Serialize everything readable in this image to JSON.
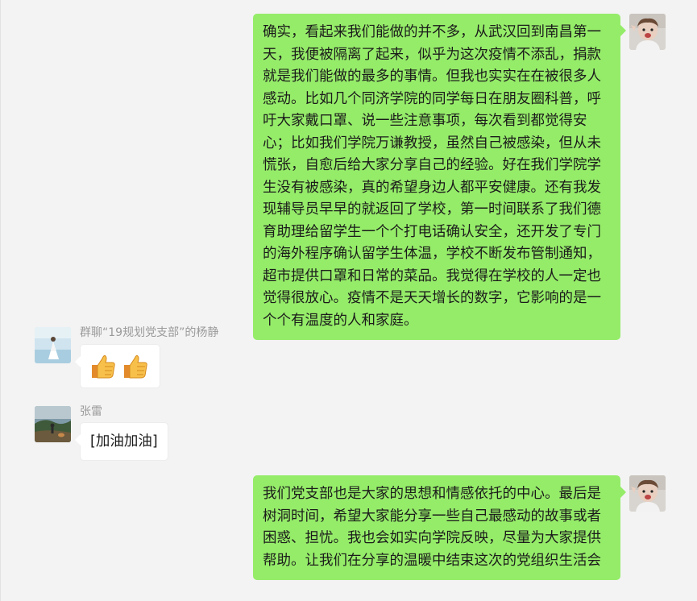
{
  "messages": [
    {
      "direction": "outgoing",
      "avatar": "child-photo-avatar",
      "text": "确实，看起来我们能做的并不多，从武汉回到南昌第一天，我便被隔离了起来，似乎为这次疫情不添乱，捐款就是我们能做的最多的事情。但我也实实在在被很多人感动。比如几个同济学院的同学每日在朋友圈科普，呼吁大家戴口罩、说一些注意事项，每次看到都觉得安心；比如我们学院万谦教授，虽然自己被感染，但从未慌张，自愈后给大家分享自己的经验。好在我们学院学生没有被感染，真的希望身边人都平安健康。还有我发现辅导员早早的就返回了学校，第一时间联系了我们德育助理给留学生一个个打电话确认安全，还开发了专门的海外程序确认留学生体温，学校不断发布管制通知，超市提供口罩和日常的菜品。我觉得在学校的人一定也觉得很放心。疫情不是天天增长的数字，它影响的是一个个有温度的人和家庭。"
    },
    {
      "direction": "incoming",
      "sender": "群聊“19规划党支部”的杨静",
      "avatar": "figure-in-white-dress-avatar",
      "emoji": [
        "thumbs-up-icon",
        "thumbs-up-icon"
      ]
    },
    {
      "direction": "incoming",
      "sender": "张雷",
      "avatar": "outdoor-landscape-avatar",
      "text": "[加油加油]"
    },
    {
      "direction": "outgoing",
      "avatar": "child-photo-avatar",
      "text": "我们党支部也是大家的思想和情感依托的中心。最后是树洞时间，希望大家能分享一些自己最感动的故事或者困惑、担忧。我也会如实向学院反映，尽量为大家提供帮助。让我们在分享的温暖中结束这次的党组织生活会"
    }
  ],
  "colors": {
    "outgoing_bubble": "#95ec69",
    "incoming_bubble": "#ffffff",
    "background": "#f3f3f3",
    "sender_name": "#9a9a9a"
  }
}
